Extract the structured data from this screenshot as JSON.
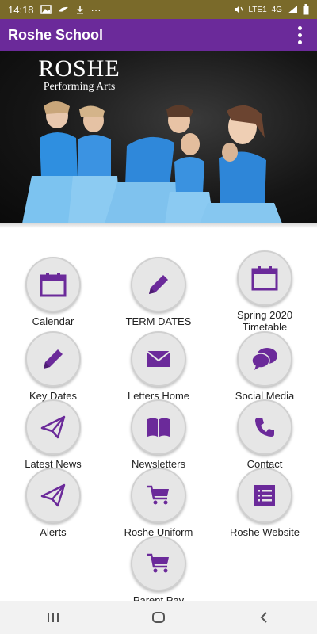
{
  "status_bar": {
    "time": "14:18",
    "more": "···",
    "network_type": "4G",
    "network_label": "LTE1",
    "colors": {
      "background": "#7a6a2a"
    }
  },
  "app_bar": {
    "title": "Roshe School",
    "menu_icon": "overflow-menu-icon",
    "colors": {
      "background": "#6b2a9a"
    }
  },
  "banner": {
    "title": "ROSHE",
    "subtitle": "Performing Arts"
  },
  "tiles": [
    {
      "label": "Calendar",
      "icon": "calendar-icon"
    },
    {
      "label": "TERM DATES",
      "icon": "pencil-icon"
    },
    {
      "label": "Spring 2020 Timetable",
      "icon": "calendar-icon"
    },
    {
      "label": "Key Dates",
      "icon": "pencil-icon"
    },
    {
      "label": "Letters Home",
      "icon": "envelope-icon"
    },
    {
      "label": "Social Media",
      "icon": "chat-bubbles-icon"
    },
    {
      "label": "Latest News",
      "icon": "paper-plane-icon"
    },
    {
      "label": "Newsletters",
      "icon": "book-icon"
    },
    {
      "label": "Contact",
      "icon": "phone-icon"
    },
    {
      "label": "Alerts",
      "icon": "paper-plane-icon"
    },
    {
      "label": "Roshe Uniform",
      "icon": "shopping-cart-icon"
    },
    {
      "label": "Roshe Website",
      "icon": "list-icon"
    },
    {
      "label": "Parent Pay",
      "icon": "shopping-cart-icon"
    }
  ],
  "nav_bar": {
    "buttons": [
      "recent-apps-icon",
      "home-icon",
      "back-icon"
    ]
  },
  "colors": {
    "accent": "#6b2a9a",
    "tile_bg": "#e6e6e6"
  }
}
